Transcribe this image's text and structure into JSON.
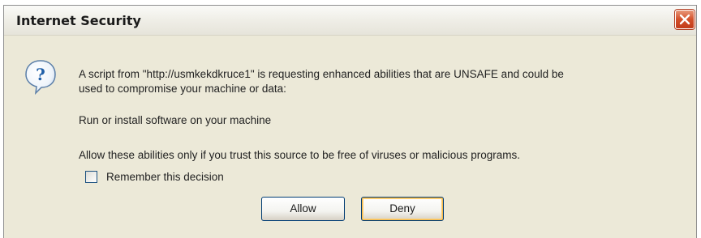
{
  "window": {
    "title": "Internet Security",
    "close_icon": "close-icon"
  },
  "message": {
    "icon": "question-icon",
    "line1": "A script from \"http://usmkekdkruce1\" is requesting enhanced abilities that are UNSAFE and could be",
    "line2": "used to compromise your machine or data:",
    "detail": "Run or install software on your machine",
    "trust_notice": "Allow these abilities only if you trust this source to be free of viruses or malicious programs."
  },
  "remember": {
    "label": "Remember this decision",
    "checked": false
  },
  "buttons": {
    "allow_label": "Allow",
    "deny_label": "Deny"
  },
  "colors": {
    "dialog_bg": "#ece9d8",
    "close_button": "#d3502a",
    "button_border": "#003c74",
    "focus_ring": "#f8b94c"
  }
}
